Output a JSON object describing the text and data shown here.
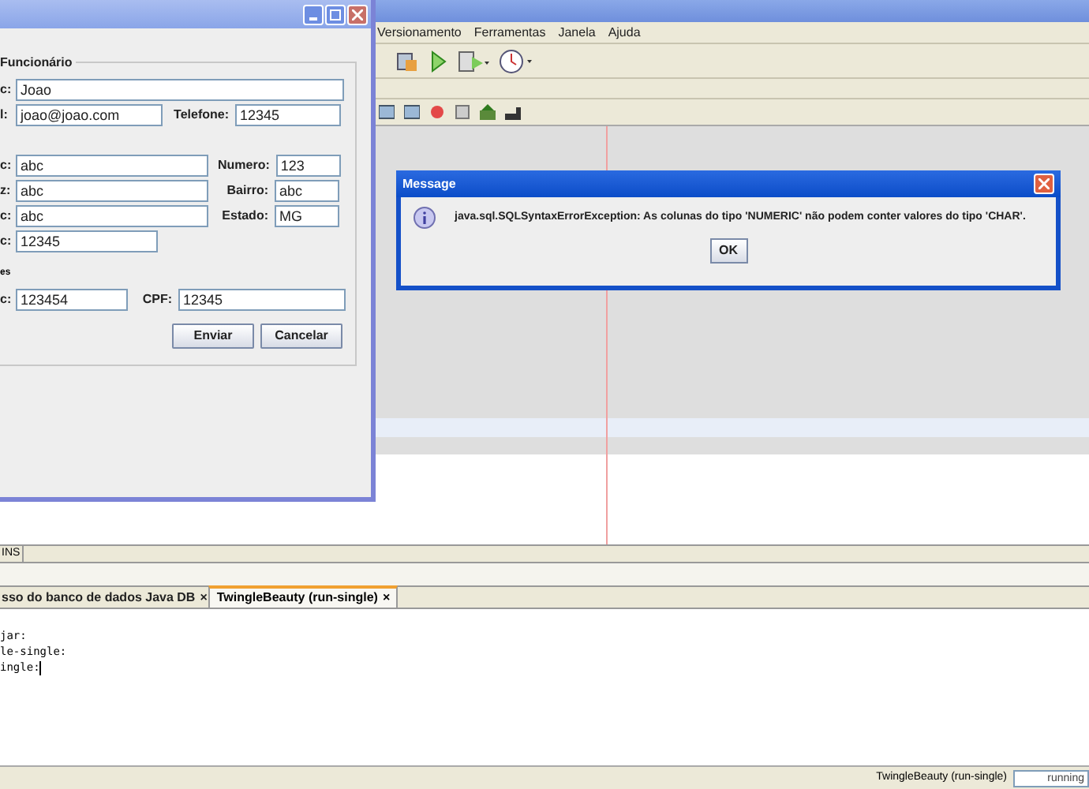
{
  "ide": {
    "menu": [
      "Versionamento",
      "Ferramentas",
      "Janela",
      "Ajuda"
    ],
    "editor_status": "INS",
    "output_tabs": [
      {
        "label": "sso do banco de dados Java DB",
        "close": "×",
        "selected": false
      },
      {
        "label": "TwingleBeauty (run-single)",
        "close": "×",
        "selected": true
      }
    ],
    "output_lines": [
      "jar:",
      "le-single:",
      "ingle:"
    ],
    "status_bar": {
      "task": "TwingleBeauty (run-single)",
      "progress_text": "running"
    }
  },
  "form": {
    "legend": "Funcionário",
    "groups": [
      {
        "rows": [
          [
            {
              "label": "c:",
              "value": "Joao"
            }
          ],
          [
            {
              "label": "l:",
              "value": "joao@joao.com"
            },
            {
              "label": "Telefone:",
              "value": "12345"
            }
          ]
        ]
      },
      {
        "rows": [
          [
            {
              "label": "c:",
              "value": "abc"
            },
            {
              "label": "Numero:",
              "value": "123"
            }
          ],
          [
            {
              "label": "z:",
              "value": "abc"
            },
            {
              "label": "Bairro:",
              "value": "abc"
            }
          ],
          [
            {
              "label": "c:",
              "value": "abc"
            },
            {
              "label": "Estado:",
              "value": "MG"
            }
          ],
          [
            {
              "label": "c:",
              "value": "12345"
            }
          ]
        ]
      },
      {
        "title": "es",
        "rows": [
          [
            {
              "label": "c:",
              "value": "123454"
            },
            {
              "label": "CPF:",
              "value": "12345"
            }
          ]
        ]
      }
    ],
    "buttons": [
      "Enviar",
      "Cancelar"
    ]
  },
  "dialog": {
    "title": "Message",
    "message": "java.sql.SQLSyntaxErrorException: As colunas do tipo 'NUMERIC' não podem conter valores do tipo 'CHAR'.",
    "button": "OK"
  }
}
